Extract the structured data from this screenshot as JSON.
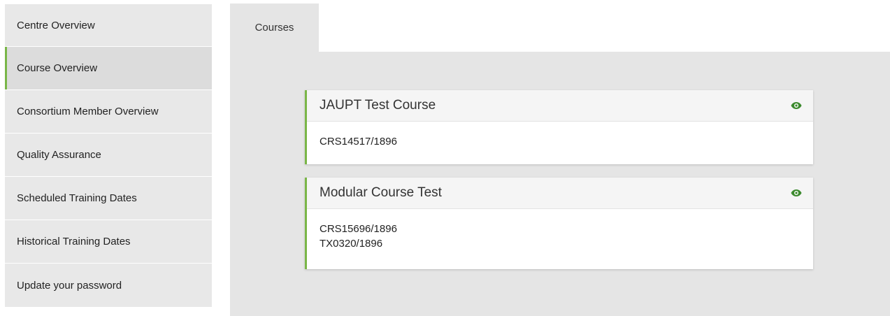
{
  "sidebar": {
    "items": [
      {
        "label": "Centre Overview",
        "active": false
      },
      {
        "label": "Course Overview",
        "active": true
      },
      {
        "label": "Consortium Member Overview",
        "active": false
      },
      {
        "label": "Quality Assurance",
        "active": false
      },
      {
        "label": "Scheduled Training Dates",
        "active": false
      },
      {
        "label": "Historical Training Dates",
        "active": false
      },
      {
        "label": "Update your password",
        "active": false
      }
    ]
  },
  "tabs": [
    {
      "label": "Courses",
      "active": true
    }
  ],
  "courses": [
    {
      "title": "JAUPT Test Course",
      "codes": [
        "CRS14517/1896"
      ],
      "icon": "eye-icon"
    },
    {
      "title": "Modular Course Test",
      "codes": [
        "CRS15696/1896",
        "TX0320/1896"
      ],
      "icon": "eye-icon"
    }
  ],
  "colors": {
    "accent_green": "#7ab648",
    "icon_green": "#3c8a2e",
    "panel_bg": "#e5e5e5",
    "sidebar_bg": "#e8e8e8"
  }
}
